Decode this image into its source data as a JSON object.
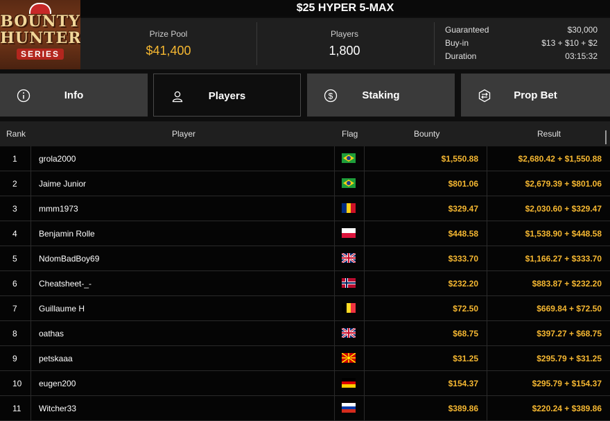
{
  "logo": {
    "line1": "BOUNTY",
    "line2": "HUNTERS",
    "line3": "SERIES"
  },
  "title": "$25 HYPER 5-MAX",
  "stats": {
    "prize_pool_label": "Prize Pool",
    "prize_pool_value": "$41,400",
    "players_label": "Players",
    "players_value": "1,800",
    "guaranteed_label": "Guaranteed",
    "guaranteed_value": "$30,000",
    "buyin_label": "Buy-in",
    "buyin_value": "$13 + $10 + $2",
    "duration_label": "Duration",
    "duration_value": "03:15:32"
  },
  "tabs": [
    {
      "label": "Info",
      "icon": "info-icon"
    },
    {
      "label": "Players",
      "icon": "user-icon"
    },
    {
      "label": "Staking",
      "icon": "dollar-coin-icon"
    },
    {
      "label": "Prop Bet",
      "icon": "prop-bet-icon"
    }
  ],
  "table": {
    "headers": {
      "rank": "Rank",
      "player": "Player",
      "flag": "Flag",
      "bounty": "Bounty",
      "result": "Result"
    },
    "rows": [
      {
        "rank": "1",
        "player": "grola2000",
        "flag": "brazil",
        "bounty": "$1,550.88",
        "result": "$2,680.42 + $1,550.88"
      },
      {
        "rank": "2",
        "player": "Jaime Junior",
        "flag": "brazil",
        "bounty": "$801.06",
        "result": "$2,679.39 + $801.06"
      },
      {
        "rank": "3",
        "player": "mmm1973",
        "flag": "romania",
        "bounty": "$329.47",
        "result": "$2,030.60 + $329.47"
      },
      {
        "rank": "4",
        "player": "Benjamin Rolle",
        "flag": "poland",
        "bounty": "$448.58",
        "result": "$1,538.90 + $448.58"
      },
      {
        "rank": "5",
        "player": "NdomBadBoy69",
        "flag": "uk",
        "bounty": "$333.70",
        "result": "$1,166.27 + $333.70"
      },
      {
        "rank": "6",
        "player": "Cheatsheet-_-",
        "flag": "norway",
        "bounty": "$232.20",
        "result": "$883.87 + $232.20"
      },
      {
        "rank": "7",
        "player": "Guillaume H",
        "flag": "belgium",
        "bounty": "$72.50",
        "result": "$669.84 + $72.50"
      },
      {
        "rank": "8",
        "player": "oathas",
        "flag": "uk",
        "bounty": "$68.75",
        "result": "$397.27 + $68.75"
      },
      {
        "rank": "9",
        "player": "petskaaa",
        "flag": "north-macedonia",
        "bounty": "$31.25",
        "result": "$295.79 + $31.25"
      },
      {
        "rank": "10",
        "player": "eugen200",
        "flag": "germany",
        "bounty": "$154.37",
        "result": "$295.79 + $154.37"
      },
      {
        "rank": "11",
        "player": "Witcher33",
        "flag": "russia",
        "bounty": "$389.86",
        "result": "$220.24 + $389.86"
      }
    ]
  },
  "colors": {
    "accent": "#f5b731",
    "tab_bg": "#3a3a3a",
    "header_bg": "#1f1f1f"
  }
}
